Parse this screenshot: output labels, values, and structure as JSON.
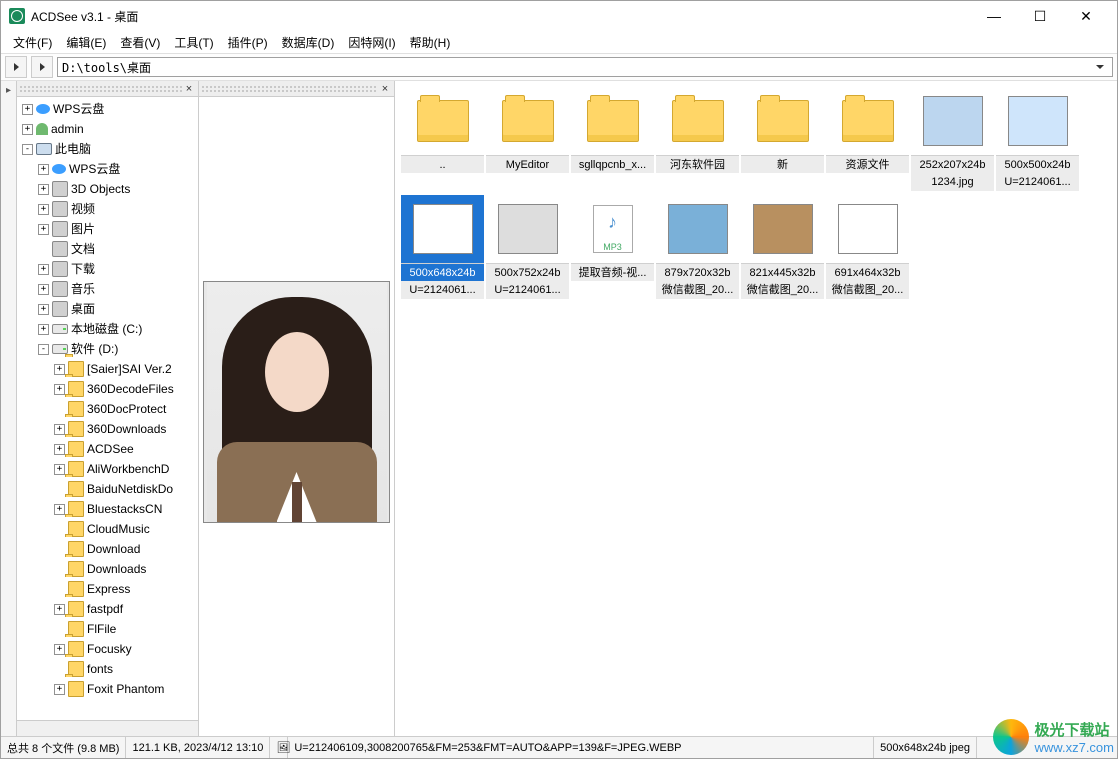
{
  "title": "ACDSee v3.1 - 桌面",
  "menus": [
    "文件(F)",
    "编辑(E)",
    "查看(V)",
    "工具(T)",
    "插件(P)",
    "数据库(D)",
    "因特网(I)",
    "帮助(H)"
  ],
  "addressPath": "D:\\tools\\桌面",
  "tree": {
    "roots": [
      {
        "exp": "+",
        "icon": "cloud",
        "label": "WPS云盘"
      },
      {
        "exp": "+",
        "icon": "user",
        "label": "admin"
      },
      {
        "exp": "-",
        "icon": "pc",
        "label": "此电脑",
        "children": [
          {
            "exp": "+",
            "icon": "cloud",
            "label": "WPS云盘",
            "pad": 1
          },
          {
            "exp": "+",
            "icon": "special",
            "label": "3D Objects",
            "pad": 1
          },
          {
            "exp": "+",
            "icon": "special",
            "label": "视频",
            "pad": 1
          },
          {
            "exp": "+",
            "icon": "special",
            "label": "图片",
            "pad": 1
          },
          {
            "exp": "",
            "icon": "special",
            "label": "文档",
            "pad": 1
          },
          {
            "exp": "+",
            "icon": "special",
            "label": "下载",
            "pad": 1
          },
          {
            "exp": "+",
            "icon": "special",
            "label": "音乐",
            "pad": 1
          },
          {
            "exp": "+",
            "icon": "special",
            "label": "桌面",
            "pad": 1
          },
          {
            "exp": "+",
            "icon": "drive",
            "label": "本地磁盘 (C:)",
            "pad": 1
          },
          {
            "exp": "-",
            "icon": "drive",
            "label": "软件 (D:)",
            "pad": 1,
            "children": [
              {
                "exp": "+",
                "icon": "folder",
                "label": "[Saier]SAI Ver.2",
                "pad": 2
              },
              {
                "exp": "+",
                "icon": "folder",
                "label": "360DecodeFiles",
                "pad": 2
              },
              {
                "exp": "",
                "icon": "folder",
                "label": "360DocProtect",
                "pad": 2
              },
              {
                "exp": "+",
                "icon": "folder",
                "label": "360Downloads",
                "pad": 2
              },
              {
                "exp": "+",
                "icon": "folder",
                "label": "ACDSee",
                "pad": 2
              },
              {
                "exp": "+",
                "icon": "folder",
                "label": "AliWorkbenchD",
                "pad": 2
              },
              {
                "exp": "",
                "icon": "folder",
                "label": "BaiduNetdiskDo",
                "pad": 2
              },
              {
                "exp": "+",
                "icon": "folder",
                "label": "BluestacksCN",
                "pad": 2
              },
              {
                "exp": "",
                "icon": "folder",
                "label": "CloudMusic",
                "pad": 2
              },
              {
                "exp": "",
                "icon": "folder",
                "label": "Download",
                "pad": 2
              },
              {
                "exp": "",
                "icon": "folder",
                "label": "Downloads",
                "pad": 2
              },
              {
                "exp": "",
                "icon": "folder",
                "label": "Express",
                "pad": 2
              },
              {
                "exp": "+",
                "icon": "folder",
                "label": "fastpdf",
                "pad": 2
              },
              {
                "exp": "",
                "icon": "folder",
                "label": "FlFile",
                "pad": 2
              },
              {
                "exp": "+",
                "icon": "folder",
                "label": "Focusky",
                "pad": 2
              },
              {
                "exp": "",
                "icon": "folder",
                "label": "fonts",
                "pad": 2
              },
              {
                "exp": "+",
                "icon": "folder",
                "label": "Foxit Phantom",
                "pad": 2
              }
            ]
          }
        ]
      }
    ]
  },
  "thumbsRow1": [
    {
      "type": "folder",
      "label": "..",
      "dim": ""
    },
    {
      "type": "folder",
      "label": "MyEditor",
      "dim": ""
    },
    {
      "type": "folder",
      "label": "sgllqpcnb_x...",
      "dim": ""
    },
    {
      "type": "folder",
      "label": "河东软件园",
      "dim": ""
    },
    {
      "type": "folder",
      "label": "新",
      "dim": ""
    },
    {
      "type": "folder",
      "label": "资源文件",
      "dim": ""
    },
    {
      "type": "img",
      "label": "1234.jpg",
      "dim": "252x207x24b",
      "bg": "#bcd6ef"
    },
    {
      "type": "img",
      "label": "U=2124061...",
      "dim": "500x500x24b",
      "bg": "#cfe5fb"
    }
  ],
  "thumbsRow2": [
    {
      "type": "img",
      "label": "U=2124061...",
      "dim": "500x648x24b",
      "selected": true,
      "bg": "#fff"
    },
    {
      "type": "img",
      "label": "U=2124061...",
      "dim": "500x752x24b",
      "bg": "#ddd"
    },
    {
      "type": "mp3",
      "label": "提取音频-视...",
      "dim": ""
    },
    {
      "type": "img",
      "label": "微信截图_20...",
      "dim": "879x720x32b",
      "bg": "#7ab0d8"
    },
    {
      "type": "img",
      "label": "微信截图_20...",
      "dim": "821x445x32b",
      "bg": "#b89060"
    },
    {
      "type": "img",
      "label": "微信截图_20...",
      "dim": "691x464x32b",
      "bg": "#fff"
    }
  ],
  "status": {
    "total": "总共 8 个文件 (9.8 MB)",
    "fileinfo": "121.1 KB, 2023/4/12 13:10",
    "filename": "U=212406109,3008200765&FM=253&FMT=AUTO&APP=139&F=JPEG.WEBP",
    "dims": "500x648x24b  jpeg"
  },
  "mp3Label": "MP3",
  "watermark": {
    "brand": "极光下载站",
    "url": "www.xz7.com"
  }
}
